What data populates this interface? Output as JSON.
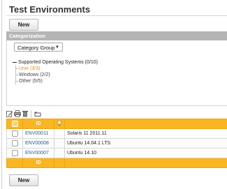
{
  "page": {
    "title": "Test Environments"
  },
  "buttons": {
    "new_top": "New",
    "new_bottom": "New"
  },
  "categorization": {
    "header": "Categorization",
    "select_value": "Category Group",
    "root": "Supported Operating Systems (0/10)",
    "children": [
      {
        "label": "Unix (3/3)",
        "active": true
      },
      {
        "label": "Windows (2/2)",
        "active": false
      },
      {
        "label": "Other (5/5)",
        "active": false
      }
    ]
  },
  "toolbar": {
    "icons": [
      "edit-icon",
      "print-icon",
      "delete-icon",
      "folder-icon"
    ]
  },
  "table": {
    "header_id": "ID",
    "footer_id": "ID",
    "rows": [
      {
        "id": "ENV00011",
        "name": "Solaris 11 2011.11"
      },
      {
        "id": "ENV00008",
        "name": "Ubuntu 14.04.1 LTS"
      },
      {
        "id": "ENV00007",
        "name": "Ubuntu 14.10"
      }
    ]
  },
  "colors": {
    "accent": "#fab622",
    "link": "#1f5f9c",
    "active_tree": "#e48a1a"
  }
}
